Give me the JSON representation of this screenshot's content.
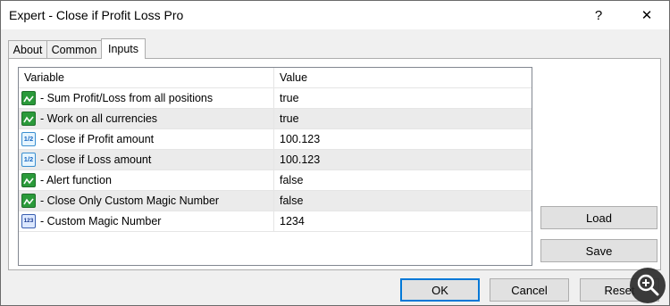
{
  "window": {
    "title": "Expert - Close if Profit Loss Pro",
    "help_glyph": "?",
    "close_glyph": "✕"
  },
  "tabs": [
    {
      "label": "About",
      "active": false
    },
    {
      "label": "Common",
      "active": false
    },
    {
      "label": "Inputs",
      "active": true
    }
  ],
  "table": {
    "headers": {
      "variable": "Variable",
      "value": "Value"
    },
    "rows": [
      {
        "icon": "bool-param-icon",
        "variable": "- Sum Profit/Loss from all positions",
        "value": "true"
      },
      {
        "icon": "bool-param-icon",
        "variable": "- Work on all currencies",
        "value": "true"
      },
      {
        "icon": "double-param-icon",
        "icon_text": "1/2",
        "variable": "- Close if Profit amount",
        "value": "100.123"
      },
      {
        "icon": "double-param-icon",
        "icon_text": "1/2",
        "variable": "- Close if Loss amount",
        "value": "100.123"
      },
      {
        "icon": "bool-param-icon",
        "variable": "- Alert function",
        "value": "false"
      },
      {
        "icon": "bool-param-icon",
        "variable": "- Close Only Custom Magic Number",
        "value": "false"
      },
      {
        "icon": "int-param-icon",
        "icon_text": "123",
        "variable": "- Custom Magic Number",
        "value": "1234"
      }
    ]
  },
  "buttons": {
    "load": "Load",
    "save": "Save",
    "ok": "OK",
    "cancel": "Cancel",
    "reset": "Reset"
  },
  "colors": {
    "accent": "#0078d7",
    "alt_row": "#ebebeb",
    "bool_icon": "#2a9a3a"
  }
}
